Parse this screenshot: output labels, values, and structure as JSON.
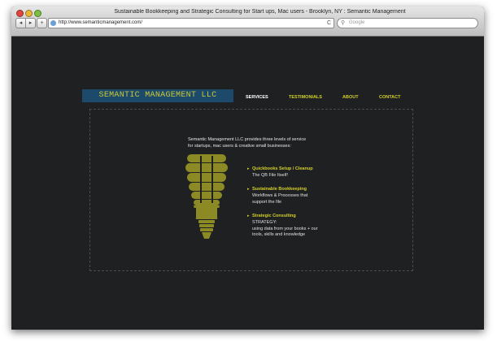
{
  "browser": {
    "window_title": "Sustainable Bookkeeping and Strategic Consulting for Start ups, Mac users - Brooklyn, NY : Semantic Management",
    "back_label": "◂",
    "forward_label": "▸",
    "add_label": "+",
    "url": "http://www.semanticmanagement.com/",
    "reload_icon": "C",
    "search_placeholder": "Google"
  },
  "site": {
    "logo": "SEMANTIC MANAGEMENT LLC",
    "nav": [
      {
        "label": "SERVICES"
      },
      {
        "label": "TESTIMONIALS"
      },
      {
        "label": "ABOUT"
      },
      {
        "label": "CONTACT"
      }
    ],
    "intro": [
      "Semantic Management LLC provides three levels of service",
      "for startups, mac users & creative small businesses:"
    ],
    "services": [
      {
        "title": "Quickbooks Setup / Cleanup",
        "desc": [
          "The QB File Itself!"
        ]
      },
      {
        "title": "Sustainable Bookkeeping",
        "desc": [
          "Workflows & Processes that",
          "support the file"
        ]
      },
      {
        "title": "Strategic Consulting",
        "desc": [
          "STRATEGY:",
          "using data from your books + our",
          "tools, skills and knowledge"
        ]
      }
    ],
    "bullet_glyph": "▸",
    "colors": {
      "accent": "#d4cf2a",
      "logo_bg": "#1d4a6a",
      "background": "#1e2022",
      "bulb": "#8c8a25"
    }
  }
}
